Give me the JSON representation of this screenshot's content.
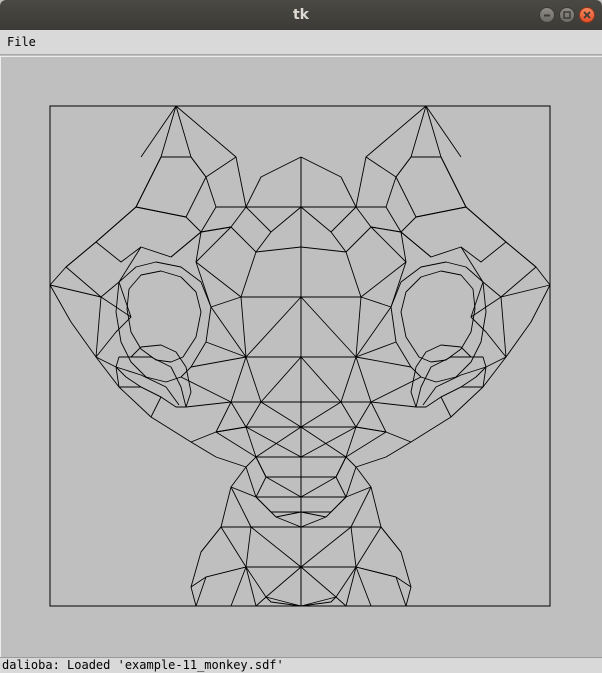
{
  "window": {
    "title": "tk"
  },
  "menubar": {
    "items": [
      {
        "label": "File"
      }
    ]
  },
  "canvas": {
    "content": "wireframe monkey mesh"
  },
  "statusbar": {
    "message": "dalioba: Loaded 'example-11_monkey.sdf'"
  },
  "colors": {
    "titlebar": "#3c3b37",
    "close_button": "#e95420",
    "canvas_background": "#bfbfbf",
    "line": "#000000"
  }
}
